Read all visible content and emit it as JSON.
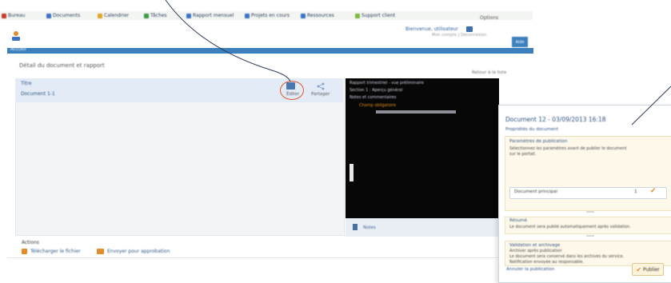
{
  "bookmarks": [
    {
      "label": "Bureau",
      "color": "#c63a2c"
    },
    {
      "label": "Documents",
      "color": "#3a72c6"
    },
    {
      "label": "Calendrier",
      "color": "#e3a526"
    },
    {
      "label": "Tâches",
      "color": "#3a9a4a"
    },
    {
      "label": "Rapport mensuel",
      "color": "#3a72c6"
    },
    {
      "label": "Projets en cours",
      "color": "#3a72c6"
    },
    {
      "label": "Ressources",
      "color": "#3a72c6"
    },
    {
      "label": "Support client",
      "color": "#7dbb3b"
    }
  ],
  "top_right": "Options",
  "header": {
    "tab_home": "Accueil",
    "user_link": "Bienvenue, utilisateur",
    "user_sub": "Mon compte  |  Déconnexion",
    "user_button": "Aide"
  },
  "page": {
    "title": "Détail du document et rapport",
    "top_link": "Retour à la liste"
  },
  "list": {
    "row1": "Titre",
    "row2": "Document 1-1",
    "edit_label": "Éditer",
    "share_label": "Partager"
  },
  "preview": {
    "lines": [
      "Rapport trimestriel - vue préliminaire",
      "Section 1 : Aperçu général",
      "Notes et commentaires"
    ],
    "orange_text": "Champ obligatoire",
    "note": "Notes"
  },
  "actions": {
    "title": "Actions",
    "a1": "Télécharger le fichier",
    "a2": "Envoyer pour approbation"
  },
  "popup": {
    "title": "Document 12  -  03/09/2013 16:18",
    "subtitle": "Propriétés du document",
    "box1_head": "Paramètres de publication",
    "box1_line1": "Sélectionnez les paramètres avant de publier le document",
    "box1_line2": "sur le portail.",
    "input_value": "Document principal",
    "input_num": "1",
    "box2_head": "Résumé",
    "box2_line": "Le document sera publié automatiquement après validation.",
    "box4_head": "Validation et archivage",
    "box4_line1": "Archiver après publication",
    "box4_line2": "Le document sera conservé dans les archives du service.",
    "box4_line3": "Notification envoyée au responsable.",
    "footer_link": "Annuler la publication",
    "ok": "Publier"
  }
}
